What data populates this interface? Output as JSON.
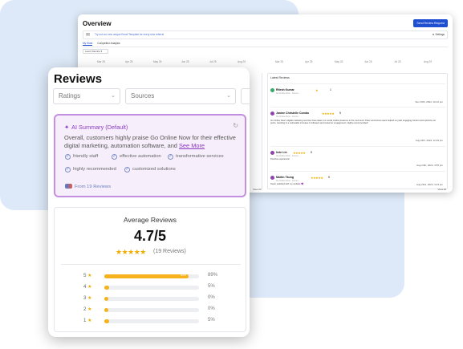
{
  "overview": {
    "title": "Overview",
    "action_button": "Send Review Request",
    "banner_text": "Try out our new unique Email Template for every new referral",
    "settings_label": "Settings",
    "tabs": [
      "My Stats",
      "Competitor Analysis"
    ],
    "date_select": "Last 6 Months",
    "axis_labels": [
      "Mar 25",
      "Apr 25",
      "May 25",
      "Jun 25",
      "Jul 25",
      "Aug 25",
      "Mar 25",
      "Apr 25",
      "May 25",
      "Jun 25",
      "Jul 25",
      "Aug 25"
    ],
    "latest_reviews_title": "Latest Reviews",
    "view_all_left": "View All",
    "view_all_right": "View All",
    "reviews": [
      {
        "name": "Ritesh Kumar",
        "source": "Go Online Now · Comm...",
        "stars": "★",
        "score": "1",
        "body": "",
        "date": "Sun 15th, 2024, 10:12 pm"
      },
      {
        "name": "Janine Christelle Combo",
        "source": "Go Online Now · Comm...",
        "stars": "★★★★★",
        "score": "5",
        "body": "Go Online Now's digital marketing services have taken our social media presence to the next level. Peter and Anna's team helped us push engaging content and optimize our posts, resulting in a noticeable increase in followers and customer engagement. Highly recommended!",
        "date": "Aug 24th, 2024, 11:29 pm"
      },
      {
        "name": "Irvin Lin",
        "source": "Go Online Now · Comm...",
        "stars": "★★★★★",
        "score": "5",
        "body": "Positive experience!",
        "date": "Aug 24th, 2024, 3:55 pm"
      },
      {
        "name": "Martin Tkung",
        "source": "Go Online Now · Comm...",
        "stars": "★★★★★",
        "score": "5",
        "body": "Super satisfied with my website 💜",
        "date": "Aug 23rd, 2024, 3:43 pm"
      }
    ]
  },
  "reviews_card": {
    "title": "Reviews",
    "filters": [
      "Ratings",
      "Sources"
    ],
    "ai_summary": {
      "heading": "AI Summary (Default)",
      "text": "Overall, customers highly praise Go Online Now for their effective digital marketing, automation software, and",
      "see_more": "See More",
      "tags": [
        "friendly staff",
        "effective automation",
        "transformative services",
        "highly recommended",
        "customized solutions"
      ],
      "from": "From 19 Reviews"
    },
    "average": {
      "title": "Average Reviews",
      "score": "4.7/5",
      "stars": "★★★★★",
      "count": "(19 Reviews)",
      "rows": [
        {
          "label": "5",
          "percent": "89%",
          "value": 89
        },
        {
          "label": "4",
          "percent": "5%",
          "value": 5
        },
        {
          "label": "3",
          "percent": "0%",
          "value": 0
        },
        {
          "label": "2",
          "percent": "0%",
          "value": 0
        },
        {
          "label": "1",
          "percent": "5%",
          "value": 5
        }
      ]
    }
  },
  "colors": {
    "accent_purple": "#8a39c0",
    "brand_blue": "#1f4fd1",
    "star_gold": "#f0ad00",
    "background_blue": "#dde9f8"
  }
}
